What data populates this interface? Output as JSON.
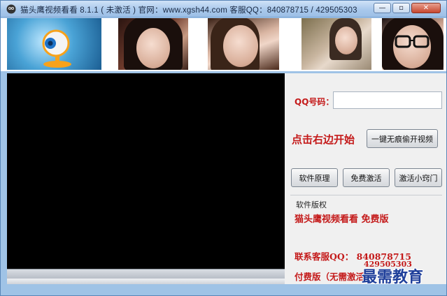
{
  "window": {
    "title": "猫头鹰视频看看 8.1.1 ( 未激活 ) 官网：www.xgsh44.com  客服QQ：840878715 / 429505303",
    "controls": {
      "minimize": "—",
      "maximize": "▫",
      "close": "✕"
    }
  },
  "thumbnails": {
    "icons": [
      "webcam-thumbnail",
      "girl-thumbnail-1",
      "girl-thumbnail-2",
      "girl-thumbnail-3",
      "girl-thumbnail-4"
    ]
  },
  "panel": {
    "qq_label": "QQ号码：",
    "qq_value": "",
    "start_label": "点击右边开始",
    "open_button": "一键无痕偷开视频",
    "principle_button": "软件原理",
    "free_button": "免费激活",
    "trick_button": "激活小窍门"
  },
  "copyright": {
    "title": "软件版权",
    "app_name": "猫头鹰视频看看  免费版",
    "contact_label": "联系客服QQ：  840878715",
    "contact_second": "429505303",
    "paid_label": "付费版（无需激活）"
  },
  "watermark": "最需教育",
  "colors": {
    "accent_red": "#c41a1a",
    "titlebar": "#a9c9ec",
    "video_bg": "#000000",
    "watermark_blue": "#1f3f9a"
  }
}
